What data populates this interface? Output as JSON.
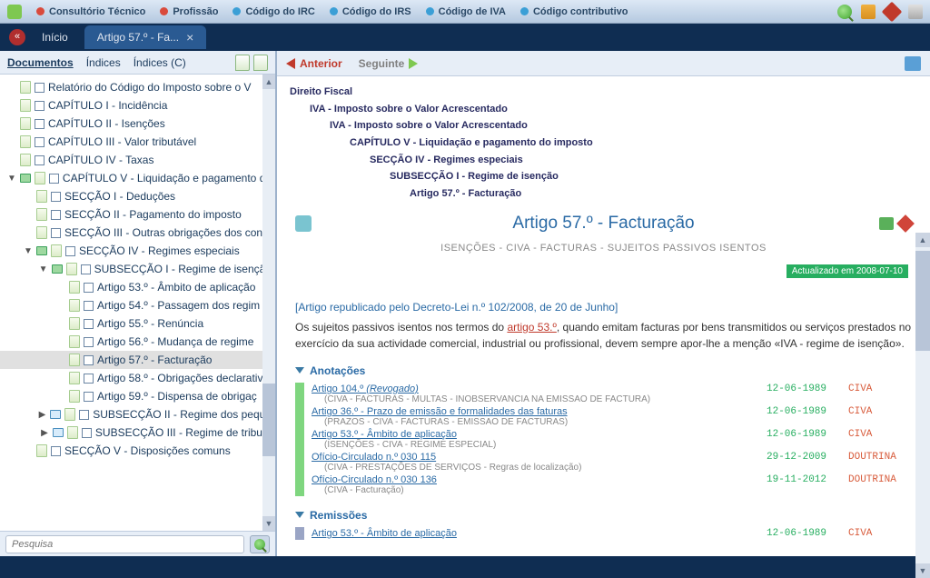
{
  "topbar": {
    "items": [
      {
        "label": "Consultório Técnico",
        "color": "red"
      },
      {
        "label": "Profissão",
        "color": "red"
      },
      {
        "label": "Código do IRC",
        "color": "blue"
      },
      {
        "label": "Código do IRS",
        "color": "blue"
      },
      {
        "label": "Código de IVA",
        "color": "blue"
      },
      {
        "label": "Código contributivo",
        "color": "blue"
      }
    ]
  },
  "tabs": {
    "inicio": "Início",
    "active": "Artigo 57.º - Fa..."
  },
  "sidebar": {
    "tabs": {
      "documentos": "Documentos",
      "indices": "Índices",
      "indicesc": "Índices (C)"
    },
    "search_placeholder": "Pesquisa"
  },
  "tree": [
    {
      "indent": 0,
      "icon": "page",
      "label": "Relatório do Código do Imposto sobre o V"
    },
    {
      "indent": 0,
      "icon": "page",
      "label": "CAPÍTULO I - Incidência"
    },
    {
      "indent": 0,
      "icon": "page",
      "label": "CAPÍTULO II - Isenções"
    },
    {
      "indent": 0,
      "icon": "page",
      "label": "CAPÍTULO III - Valor tributável"
    },
    {
      "indent": 0,
      "icon": "page",
      "label": "CAPÍTULO IV - Taxas"
    },
    {
      "indent": 0,
      "icon": "book-open",
      "arrow": "down",
      "label": "CAPÍTULO V - Liquidação e pagamento do"
    },
    {
      "indent": 1,
      "icon": "page",
      "label": "SECÇÃO I - Deduções"
    },
    {
      "indent": 1,
      "icon": "page",
      "label": "SECÇÃO II - Pagamento do imposto"
    },
    {
      "indent": 1,
      "icon": "page",
      "label": "SECÇÃO III - Outras obrigações dos con"
    },
    {
      "indent": 1,
      "icon": "book-open",
      "arrow": "down",
      "label": "SECÇÃO IV - Regimes especiais"
    },
    {
      "indent": 2,
      "icon": "book-open",
      "arrow": "down",
      "label": "SUBSECÇÃO I - Regime de isenção"
    },
    {
      "indent": 3,
      "icon": "page",
      "label": "Artigo 53.º - Âmbito de aplicação"
    },
    {
      "indent": 3,
      "icon": "page",
      "label": "Artigo 54.º - Passagem dos regim"
    },
    {
      "indent": 3,
      "icon": "page",
      "label": "Artigo 55.º - Renúncia"
    },
    {
      "indent": 3,
      "icon": "page",
      "label": "Artigo  56.º - Mudança de regime"
    },
    {
      "indent": 3,
      "icon": "page",
      "label": "Artigo 57.º - Facturação",
      "selected": true
    },
    {
      "indent": 3,
      "icon": "page",
      "label": "Artigo 58.º - Obrigações declarativ"
    },
    {
      "indent": 3,
      "icon": "page",
      "label": "Artigo 59.º - Dispensa de obrigaç"
    },
    {
      "indent": 2,
      "icon": "book",
      "arrow": "right",
      "label": "SUBSECÇÃO II - Regime dos peque"
    },
    {
      "indent": 2,
      "icon": "book",
      "arrow": "right",
      "label": "SUBSECÇÃO III - Regime de tributa"
    },
    {
      "indent": 1,
      "icon": "page",
      "label": "SECÇÃO V - Disposições comuns"
    }
  ],
  "nav": {
    "prev": "Anterior",
    "next": "Seguinte"
  },
  "crumbs": [
    {
      "indent": 0,
      "text": "Direito Fiscal"
    },
    {
      "indent": 1,
      "text": "IVA - Imposto sobre o Valor Acrescentado"
    },
    {
      "indent": 2,
      "text": "IVA - Imposto sobre o Valor Acrescentado"
    },
    {
      "indent": 3,
      "text": "CAPÍTULO V - Liquidação e pagamento do imposto"
    },
    {
      "indent": 4,
      "text": "SECÇÃO IV - Regimes especiais"
    },
    {
      "indent": 5,
      "text": "SUBSECÇÃO I - Regime de isenção"
    },
    {
      "indent": 6,
      "text": "Artigo 57.º - Facturação"
    }
  ],
  "article": {
    "title": "Artigo 57.º - Facturação",
    "keywords": "ISENÇÕES - CIVA - FACTURAS - SUJEITOS PASSIVOS ISENTOS",
    "updated": "Actualizado em 2008-07-10",
    "repub": "[Artigo republicado pelo Decreto-Lei n.º 102/2008, de 20 de Junho]",
    "body_pre": "Os sujeitos passivos isentos nos termos do ",
    "body_link": "artigo 53.º",
    "body_post": ", quando emitam facturas por bens transmitidos ou serviços prestados no exercício da sua actividade comercial, industrial ou profissional, devem sempre apor-lhe a menção «IVA - regime de isenção».",
    "sec_anot": "Anotações",
    "sec_rem": "Remissões"
  },
  "annots": [
    {
      "link": "Artigo 104.º ",
      "link_extra": "(Revogado)",
      "sub": "(CIVA - FACTURAS - MULTAS - INOBSERVANCIA NA EMISSAO DE FACTURA)",
      "date": "12-06-1989",
      "type": "CIVA"
    },
    {
      "link": "Artigo 36.º - Prazo de emissão e formalidades das faturas",
      "sub": "(PRAZOS - CIVA - FACTURAS - EMISSAO DE FACTURAS)",
      "date": "12-06-1989",
      "type": "CIVA"
    },
    {
      "link": "Artigo 53.º - Âmbito de aplicação",
      "sub": "(ISENÇÕES - CIVA - REGIME ESPECIAL)",
      "date": "12-06-1989",
      "type": "CIVA"
    },
    {
      "link": "Ofício-Circulado n.º 030 115",
      "sub": "(CIVA - PRESTAÇÕES DE SERVIÇOS - Regras de localização)",
      "date": "29-12-2009",
      "type": "DOUTRINA"
    },
    {
      "link": "Ofício-Circulado n.º 030 136",
      "sub": "(CIVA - Facturação)",
      "date": "19-11-2012",
      "type": "DOUTRINA"
    }
  ],
  "remiss": [
    {
      "link": "Artigo 53.º - Âmbito de aplicação",
      "date": "12-06-1989",
      "type": "CIVA"
    }
  ]
}
